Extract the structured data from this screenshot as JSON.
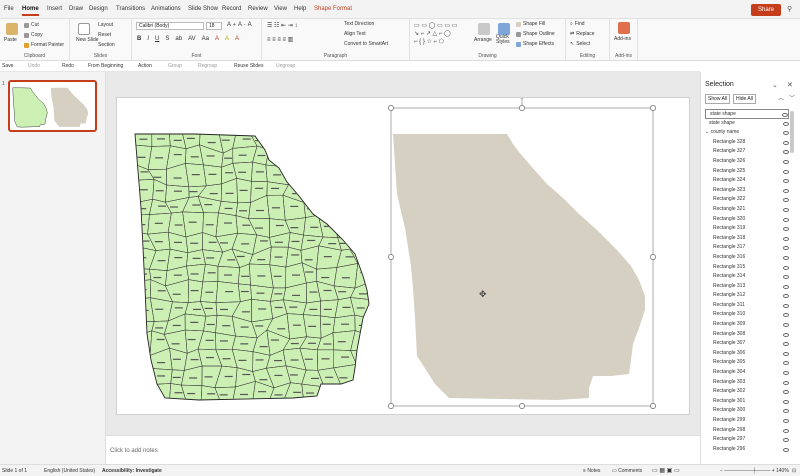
{
  "menu": {
    "tabs": [
      "File",
      "Home",
      "Insert",
      "Draw",
      "Design",
      "Transitions",
      "Animations",
      "Slide Show",
      "Record",
      "Review",
      "View",
      "Help",
      "Shape Format"
    ],
    "share_label": "Share"
  },
  "ribbon": {
    "clipboard": {
      "paste": "Paste",
      "cut": "Cut",
      "copy": "Copy",
      "format_painter": "Format Painter",
      "label": "Clipboard"
    },
    "slides": {
      "new_slide": "New Slide",
      "layout": "Layout",
      "reset": "Reset",
      "section": "Section",
      "label": "Slides"
    },
    "font": {
      "font_name": "Calibri (Body)",
      "font_size": "18",
      "label": "Font"
    },
    "paragraph": {
      "text_direction": "Text Direction",
      "align_text": "Align Text",
      "convert_smartart": "Convert to SmartArt",
      "label": "Paragraph"
    },
    "drawing": {
      "arrange": "Arrange",
      "quick_styles": "Quick Styles",
      "shape_fill": "Shape Fill",
      "shape_outline": "Shape Outline",
      "shape_effects": "Shape Effects",
      "label": "Drawing"
    },
    "editing": {
      "find": "Find",
      "replace": "Replace",
      "select": "Select",
      "label": "Editing"
    },
    "addins": {
      "addins": "Add-ins",
      "label": "Add-ins"
    }
  },
  "qat": {
    "save": "Save",
    "undo": "Undo",
    "redo": "Redo",
    "from_beginning": "From Beginning",
    "action": "Action",
    "group": "Group",
    "regroup": "Regroup",
    "reuse_slides": "Reuse Slides",
    "ungroup": "Ungroup"
  },
  "thumbs": {
    "number": "1"
  },
  "notes": {
    "placeholder": "Click to add notes"
  },
  "selection_pane": {
    "title": "Selection",
    "show_all": "Show All",
    "hide_all": "Hide All",
    "items": [
      {
        "label": "state shape",
        "indent": 0,
        "selected": true
      },
      {
        "label": "state shape",
        "indent": 0
      },
      {
        "label": "county name",
        "indent": 0,
        "group": true
      },
      {
        "label": "Rectangle 328",
        "indent": 1
      },
      {
        "label": "Rectangle 327",
        "indent": 1
      },
      {
        "label": "Rectangle 326",
        "indent": 1
      },
      {
        "label": "Rectangle 325",
        "indent": 1
      },
      {
        "label": "Rectangle 324",
        "indent": 1
      },
      {
        "label": "Rectangle 323",
        "indent": 1
      },
      {
        "label": "Rectangle 322",
        "indent": 1
      },
      {
        "label": "Rectangle 321",
        "indent": 1
      },
      {
        "label": "Rectangle 320",
        "indent": 1
      },
      {
        "label": "Rectangle 319",
        "indent": 1
      },
      {
        "label": "Rectangle 318",
        "indent": 1
      },
      {
        "label": "Rectangle 317",
        "indent": 1
      },
      {
        "label": "Rectangle 316",
        "indent": 1
      },
      {
        "label": "Rectangle 315",
        "indent": 1
      },
      {
        "label": "Rectangle 314",
        "indent": 1
      },
      {
        "label": "Rectangle 313",
        "indent": 1
      },
      {
        "label": "Rectangle 312",
        "indent": 1
      },
      {
        "label": "Rectangle 311",
        "indent": 1
      },
      {
        "label": "Rectangle 310",
        "indent": 1
      },
      {
        "label": "Rectangle 309",
        "indent": 1
      },
      {
        "label": "Rectangle 308",
        "indent": 1
      },
      {
        "label": "Rectangle 307",
        "indent": 1
      },
      {
        "label": "Rectangle 306",
        "indent": 1
      },
      {
        "label": "Rectangle 305",
        "indent": 1
      },
      {
        "label": "Rectangle 304",
        "indent": 1
      },
      {
        "label": "Rectangle 303",
        "indent": 1
      },
      {
        "label": "Rectangle 302",
        "indent": 1
      },
      {
        "label": "Rectangle 301",
        "indent": 1
      },
      {
        "label": "Rectangle 300",
        "indent": 1
      },
      {
        "label": "Rectangle 299",
        "indent": 1
      },
      {
        "label": "Rectangle 298",
        "indent": 1
      },
      {
        "label": "Rectangle 297",
        "indent": 1
      },
      {
        "label": "Rectangle 296",
        "indent": 1
      }
    ]
  },
  "status": {
    "slide": "Slide 1 of 1",
    "language": "English (United States)",
    "accessibility": "Accessibility: Investigate",
    "notes": "Notes",
    "comments": "Comments",
    "zoom": "140%"
  },
  "colors": {
    "accent": "#c43e1c",
    "county_fill": "#ccf0b4",
    "state_fill": "#d6d0c2"
  }
}
